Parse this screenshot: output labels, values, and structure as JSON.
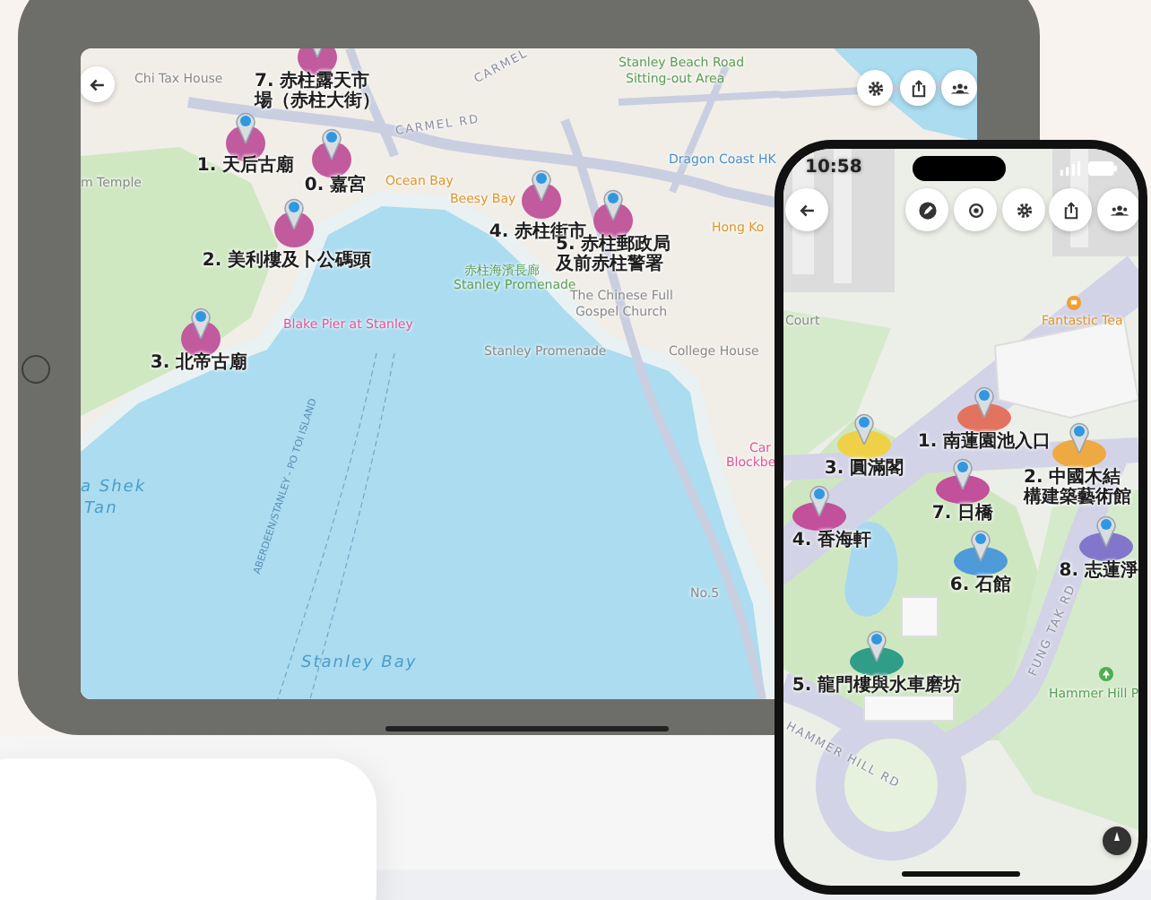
{
  "tablet": {
    "places": [
      {
        "label": "7. 赤柱露天市場（赤柱大街）",
        "color": "#c25a9e"
      },
      {
        "label": "1. 天后古廟",
        "color": "#c25a9e"
      },
      {
        "label": "0. 嘉宮",
        "color": "#c25a9e"
      },
      {
        "label": "2. 美利樓及卜公碼頭",
        "color": "#c25a9e"
      },
      {
        "label": "3. 北帝古廟",
        "color": "#c25a9e"
      },
      {
        "label": "4. 赤柱街市",
        "color": "#c25a9e"
      },
      {
        "label": "5. 赤柱郵政局及前赤柱警署",
        "color": "#c25a9e"
      }
    ],
    "map_labels": [
      {
        "text": "Chi Tax House",
        "kind": "street"
      },
      {
        "text": "CARMEL",
        "kind": "road"
      },
      {
        "text": "CARMEL RD",
        "kind": "road"
      },
      {
        "text": "Stanley Beach Road",
        "kind": "park"
      },
      {
        "text": "Sitting-out Area",
        "kind": "park"
      },
      {
        "text": "m Temple",
        "kind": "street"
      },
      {
        "text": "Ocean Bay",
        "kind": "food"
      },
      {
        "text": "Beesy Bay",
        "kind": "food"
      },
      {
        "text": "Dragon Coast HK",
        "kind": "poi"
      },
      {
        "text": "Hong Ko",
        "kind": "food"
      },
      {
        "text": "赤柱海濱長廊",
        "kind": "park"
      },
      {
        "text": "Stanley Promenade",
        "kind": "park"
      },
      {
        "text": "The Chinese Full",
        "kind": "street"
      },
      {
        "text": "Gospel Church",
        "kind": "street"
      },
      {
        "text": "Stanley Promenade",
        "kind": "street"
      },
      {
        "text": "College House",
        "kind": "street"
      },
      {
        "text": "Blake Pier at Stanley",
        "kind": "place"
      },
      {
        "text": "ABERDEEN/STANLEY - PO TOI ISLAND",
        "kind": "ferry"
      },
      {
        "text": "a Shek",
        "kind": "water"
      },
      {
        "text": "Tan",
        "kind": "water"
      },
      {
        "text": "Stanley Bay",
        "kind": "water"
      },
      {
        "text": "Car",
        "kind": "place"
      },
      {
        "text": "Blockbe",
        "kind": "place"
      },
      {
        "text": "No.5",
        "kind": "street"
      }
    ]
  },
  "phone": {
    "status_bar": {
      "time": "10:58"
    },
    "places": [
      {
        "label": "1. 南蓮園池入口",
        "color": "#e2735e"
      },
      {
        "label": "3. 圓滿閣",
        "color": "#efd148"
      },
      {
        "label": "2. 中國木結構建築藝術館",
        "color": "#eea941"
      },
      {
        "label": "7. 日橋",
        "color": "#c2509a"
      },
      {
        "label": "4. 香海軒",
        "color": "#c2509a"
      },
      {
        "label": "8. 志蓮淨",
        "color": "#8276cc"
      },
      {
        "label": "6. 石館",
        "color": "#4f9ad8"
      },
      {
        "label": "5. 龍門樓與水車磨坊",
        "color": "#2f9d88"
      }
    ],
    "map_labels": [
      {
        "text": "Court",
        "kind": "street"
      },
      {
        "text": "Fantastic Tea",
        "kind": "food"
      },
      {
        "text": "FUNG TAK RD",
        "kind": "road"
      },
      {
        "text": "HAMMER HILL RD",
        "kind": "road"
      },
      {
        "text": "Hammer Hill P",
        "kind": "park"
      }
    ]
  }
}
